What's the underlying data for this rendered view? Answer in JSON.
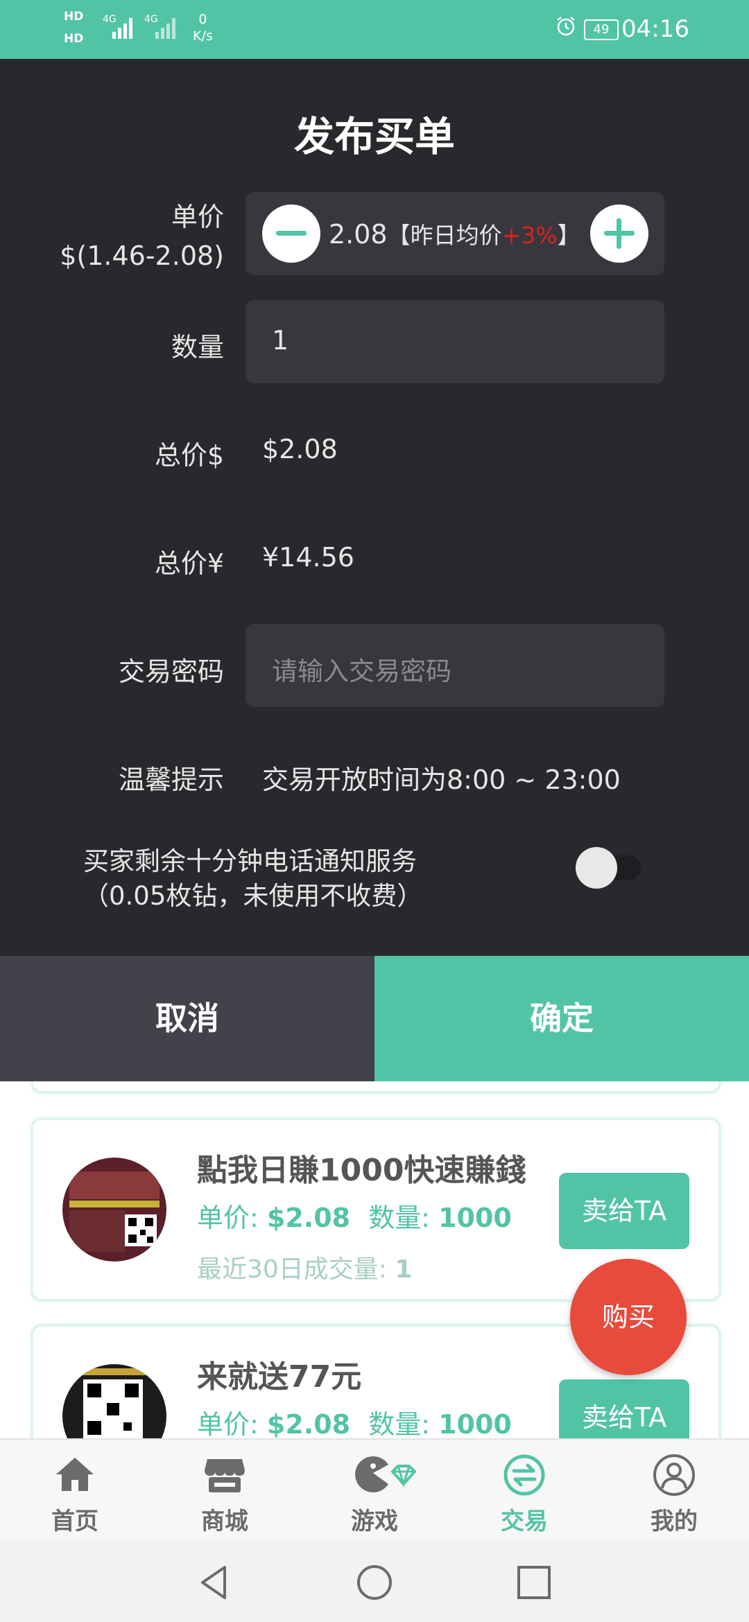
{
  "status_bar": {
    "hd1": "HD",
    "hd2": "HD",
    "sig1": "4G",
    "sig2": "4G",
    "speed_value": "0",
    "speed_unit": "K/s",
    "battery": "49",
    "time": "04:16"
  },
  "dialog": {
    "title": "发布买单",
    "unit_price_label": "单价",
    "unit_price_range": "$(1.46-2.08)",
    "unit_price_value": "2.08",
    "avg_prefix": "【昨日均价",
    "avg_change": "+3%",
    "avg_suffix": "】",
    "quantity_label": "数量",
    "quantity_value": "1",
    "total_usd_label": "总价$",
    "total_usd_value": "$2.08",
    "total_cny_label": "总价¥",
    "total_cny_value": "¥14.56",
    "password_label": "交易密码",
    "password_placeholder": "请输入交易密码",
    "tip_label": "温馨提示",
    "tip_value": "交易开放时间为8:00 ~ 23:00",
    "notify_line1": "买家剩余十分钟电话通知服务",
    "notify_line2": "（0.05枚钻，未使用不收费）",
    "notify_enabled": false,
    "cancel": "取消",
    "confirm": "确定"
  },
  "listings": [
    {
      "title": "點我日賺1000快速賺錢",
      "price_label": "单价: ",
      "price": "$2.08",
      "qty_label": "数量: ",
      "qty": "1000",
      "volume_label": "最近30日成交量: ",
      "volume": "1",
      "sell_button": "卖给TA"
    },
    {
      "title": "来就送77元",
      "price_label": "单价: ",
      "price": "$2.08",
      "qty_label": "数量: ",
      "qty": "1000",
      "sell_button": "卖给TA"
    }
  ],
  "fab_label": "购买",
  "bottom_nav": [
    {
      "label": "首页",
      "icon": "home-icon",
      "active": false
    },
    {
      "label": "商城",
      "icon": "store-icon",
      "active": false
    },
    {
      "label": "游戏",
      "icon": "game-icon",
      "active": false
    },
    {
      "label": "交易",
      "icon": "exchange-icon",
      "active": true
    },
    {
      "label": "我的",
      "icon": "profile-icon",
      "active": false
    }
  ],
  "colors": {
    "accent": "#52c4a6",
    "dialog_bg": "#29282d",
    "fab": "#e84a3c",
    "increase": "#e02020"
  }
}
